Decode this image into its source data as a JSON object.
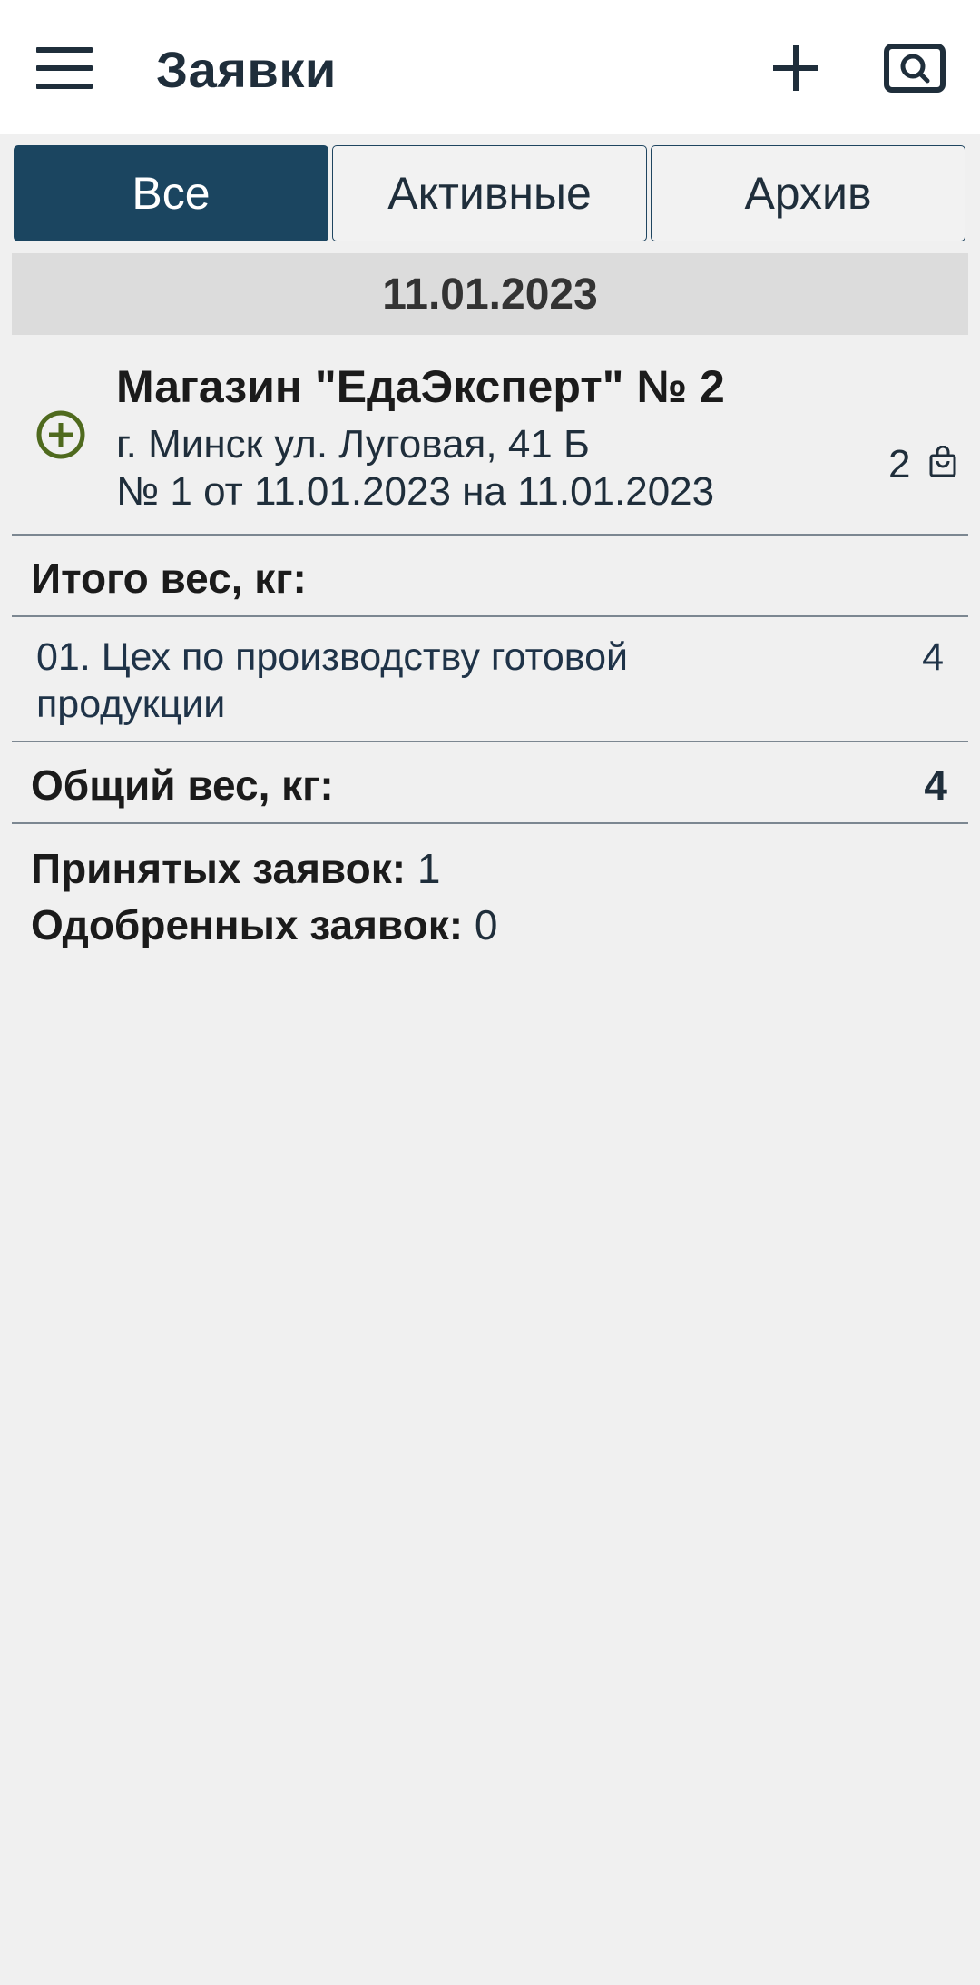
{
  "header": {
    "title": "Заявки",
    "menu_icon": "hamburger-menu-icon",
    "add_icon": "plus-icon",
    "search_icon": "search-icon"
  },
  "tabs": [
    {
      "label": "Все",
      "active": true
    },
    {
      "label": "Активные",
      "active": false
    },
    {
      "label": "Архив",
      "active": false
    }
  ],
  "date_group": "11.01.2023",
  "order": {
    "store": "Магазин \"ЕдаЭксперт\" № 2",
    "address": "г. Минск ул. Луговая, 41 Б",
    "number_line": "№ 1 от 11.01.2023 на 11.01.2023",
    "bag_count": "2",
    "expand_icon": "plus-circle-icon",
    "bag_icon": "shopping-bag-icon"
  },
  "summary": {
    "subtotal_label": "Итого вес, кг:",
    "rows": [
      {
        "name": "01. Цех по производству готовой продукции",
        "value": "4"
      }
    ],
    "total_label": "Общий вес, кг:",
    "total_value": "4",
    "accepted_label": "Принятых заявок:",
    "accepted_value": "1",
    "approved_label": "Одобренных заявок:",
    "approved_value": "0"
  },
  "colors": {
    "accent": "#1b4560",
    "text": "#1f2e3b",
    "icon_green": "#4f6a1e",
    "background": "#f0f0f0"
  }
}
